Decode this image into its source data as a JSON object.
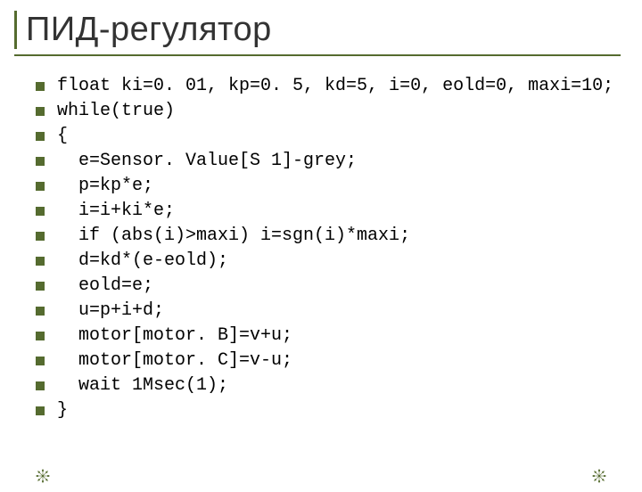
{
  "slide": {
    "title": "ПИД-регулятор",
    "code_lines": [
      "float ki=0. 01, kp=0. 5, kd=5, i=0, eold=0, maxi=10;",
      "while(true)",
      "{",
      "  e=Sensor. Value[S 1]-grey;",
      "  p=kp*e;",
      "  i=i+ki*e;",
      "  if (abs(i)>maxi) i=sgn(i)*maxi;",
      "  d=kd*(e-eold);",
      "  eold=e;",
      "  u=p+i+d;",
      "  motor[motor. B]=v+u;",
      "  motor[motor. C]=v-u;",
      "  wait 1Msec(1);",
      "}"
    ]
  }
}
